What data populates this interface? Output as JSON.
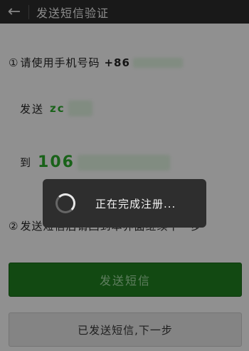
{
  "header": {
    "back_icon": "arrow-left-icon",
    "title": "发送短信验证"
  },
  "instructions": {
    "step1_marker": "①",
    "step1_text": "请使用手机号码",
    "step1_prefix": "+86",
    "send_label": "发送",
    "send_code": "zc",
    "to_label": "到",
    "to_number": "106",
    "step2_marker": "②",
    "step2_text": "发送短信后请回到本界面继续下一步"
  },
  "buttons": {
    "send_sms": "发送短信",
    "next_step": "已发送短信,下一步"
  },
  "toast": {
    "message": "正在完成注册..."
  },
  "colors": {
    "primary": "#1f7a1f",
    "code_green": "#2aa32a",
    "topbar": "#2b2b2b"
  }
}
